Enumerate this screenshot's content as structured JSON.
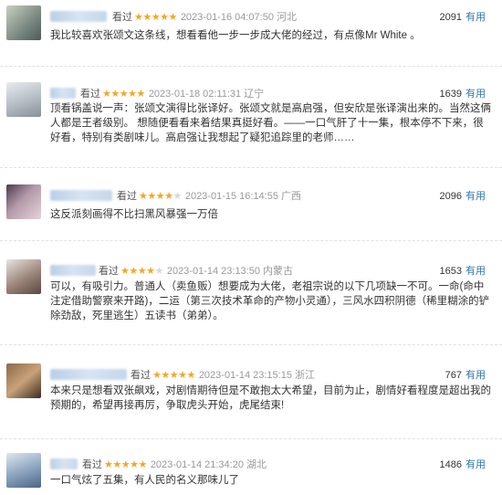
{
  "reviews": [
    {
      "status": "看过",
      "stars": "★★★★★",
      "stars_off": "",
      "time": "2023-01-16 04:07:50",
      "location": "河北",
      "votes": "2091",
      "useful_label": "有用",
      "content": "我比较喜欢张颂文这条线，想看看他一步一步成大佬的经过，有点像Mr White 。"
    },
    {
      "status": "看过",
      "stars": "★★★★★",
      "stars_off": "",
      "time": "2023-01-18 02:11:31",
      "location": "辽宁",
      "votes": "1639",
      "useful_label": "有用",
      "content": "顶看锅盖说一声：张颂文演得比张译好。张颂文就是高启强，但安欣是张译演出来的。当然这俩人都是王者级别。 想随便看看来着结果真挺好看。——一口气肝了十一集，根本停不下来，很好看，特别有类剧味儿。高启强让我想起了疑犯追踪里的老师……"
    },
    {
      "status": "看过",
      "stars": "★★★★",
      "stars_off": "★",
      "time": "2023-01-15 16:14:55",
      "location": "广西",
      "votes": "2096",
      "useful_label": "有用",
      "content": "这反派刻画得不比扫黑风暴强一万倍"
    },
    {
      "status": "看过",
      "stars": "★★★★",
      "stars_off": "★",
      "time": "2023-01-14 23:13:50",
      "location": "内蒙古",
      "votes": "1653",
      "useful_label": "有用",
      "content": "可以，有吸引力。普通人（卖鱼贩）想要成为大佬，老祖宗说的以下几项缺一不可。一命(命中注定借助警察来开路)，二运（第三次技术革命的产物小灵通），三风水四积阴德（稀里糊涂的铲除劲敌，死里逃生）五读书（弟弟）。"
    },
    {
      "status": "看过",
      "stars": "★★★★★",
      "stars_off": "",
      "time": "2023-01-14 23:15:15",
      "location": "浙江",
      "votes": "767",
      "useful_label": "有用",
      "content": "本来只是想看双张飙戏，对剧情期待但是不敢抱太大希望，目前为止，剧情好看程度是超出我的预期的，希望再接再厉，争取虎头开始，虎尾结束!"
    },
    {
      "status": "看过",
      "stars": "★★★★★",
      "stars_off": "",
      "time": "2023-01-14 21:34:20",
      "location": "湖北",
      "votes": "1486",
      "useful_label": "有用",
      "content": "一口气炫了五集，有人民的名义那味儿了"
    }
  ],
  "colors": {
    "star": "#f5a623",
    "useful": "#3377aa",
    "time": "#999999"
  }
}
